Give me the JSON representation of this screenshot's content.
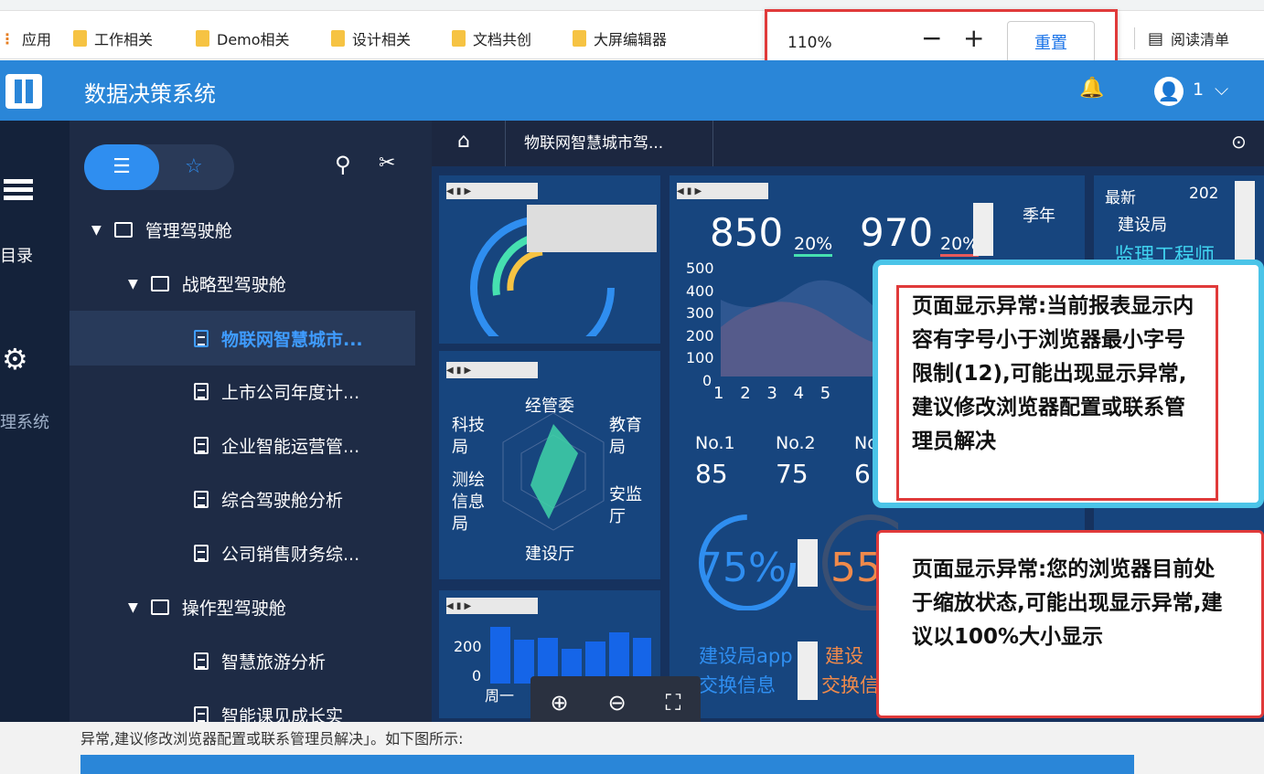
{
  "bookmarks": {
    "apps": "应用",
    "items": [
      "工作相关",
      "Demo相关",
      "设计相关",
      "文档共创",
      "大屏编辑器"
    ],
    "reading_list": "阅读清单"
  },
  "zoom": {
    "level": "110%",
    "minus": "−",
    "plus": "+",
    "reset": "重置"
  },
  "app": {
    "title": "数据决策系统",
    "user": "1"
  },
  "rail": {
    "catalog": "目录",
    "manage": "理系统"
  },
  "nav": {
    "tree": [
      {
        "label": "管理驾驶舱",
        "type": "folder",
        "level": 0
      },
      {
        "label": "战略型驾驶舱",
        "type": "folder",
        "level": 1
      },
      {
        "label": "物联网智慧城市...",
        "type": "doc",
        "level": 2,
        "active": true
      },
      {
        "label": "上市公司年度计...",
        "type": "doc",
        "level": 2
      },
      {
        "label": "企业智能运营管...",
        "type": "doc",
        "level": 2
      },
      {
        "label": "综合驾驶舱分析",
        "type": "doc",
        "level": 2
      },
      {
        "label": "公司销售财务综...",
        "type": "doc",
        "level": 2
      },
      {
        "label": "操作型驾驶舱",
        "type": "folder",
        "level": 1
      },
      {
        "label": "智慧旅游分析",
        "type": "doc",
        "level": 2
      },
      {
        "label": "智能课见成长实",
        "type": "doc",
        "level": 2
      }
    ]
  },
  "tab": {
    "label": "物联网智慧城市驾..."
  },
  "dashboard": {
    "kpi1": "850",
    "kpi1_pct": "20%",
    "kpi2": "970",
    "kpi2_pct": "20%",
    "season": "季年",
    "y_ticks": [
      "500",
      "400",
      "300",
      "200",
      "100",
      "0"
    ],
    "x_ticks": [
      "1",
      "2",
      "3",
      "4",
      "5"
    ],
    "ranks": [
      {
        "label": "No.1",
        "value": "85"
      },
      {
        "label": "No.2",
        "value": "75"
      },
      {
        "label": "No",
        "value": "6"
      }
    ],
    "radar_labels": [
      "经管委",
      "教育局",
      "安监厅",
      "建设厅",
      "测绘信息局",
      "科技局"
    ],
    "bar_y": [
      "200",
      "0"
    ],
    "bar_x": "周一",
    "gauge1": "75%",
    "gauge2": "55",
    "bottom_text1": "建设局app",
    "bottom_text2": "建设",
    "bottom_text3": "交换信息",
    "bottom_text4": "交换信",
    "right_head": "最新",
    "right_year": "202",
    "right_sub": "建设局",
    "right_role": "监理工程师"
  },
  "messages": {
    "font_warn": "页面显示异常:当前报表显示内容有字号小于浏览器最小字号限制(12),可能出现显示异常,建议修改浏览器配置或联系管理员解决",
    "zoom_warn": "页面显示异常:您的浏览器目前处于缩放状态,可能出现显示异常,建议以100%大小显示"
  },
  "background_text": "异常,建议修改浏览器配置或联系管理员解决」。如下图所示:",
  "colors": {
    "header": "#2a86d8",
    "nav": "#1e2b45",
    "panel": "#17457e",
    "accent": "#2f8ef0",
    "warn": "#e03a3a"
  }
}
